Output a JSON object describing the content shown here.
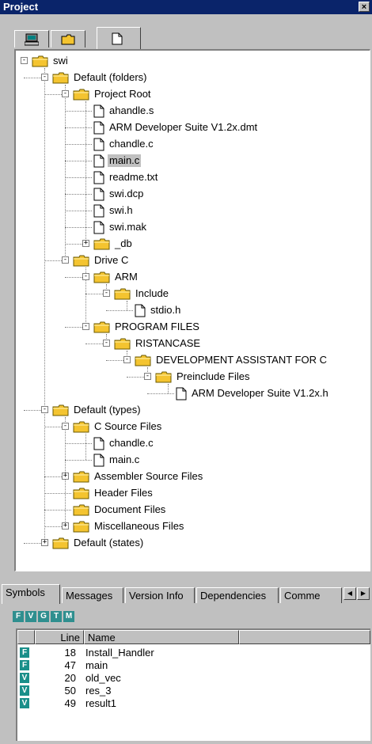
{
  "window": {
    "title": "Project",
    "close_glyph": "×"
  },
  "top_tabs": [
    {
      "icon": "computer-icon"
    },
    {
      "icon": "folder-icon"
    },
    {
      "icon": "document-icon",
      "active": true
    }
  ],
  "tree": [
    {
      "label": "swi",
      "type": "folder",
      "depth": 0,
      "expander": "-"
    },
    {
      "label": "Default (folders)",
      "type": "folder",
      "depth": 1,
      "expander": "-"
    },
    {
      "label": "Project Root",
      "type": "folder",
      "depth": 2,
      "expander": "-"
    },
    {
      "label": "ahandle.s",
      "type": "file",
      "depth": 3
    },
    {
      "label": "ARM Developer Suite V1.2x.dmt",
      "type": "file",
      "depth": 3
    },
    {
      "label": "chandle.c",
      "type": "file",
      "depth": 3
    },
    {
      "label": "main.c",
      "type": "file",
      "depth": 3,
      "selected": true
    },
    {
      "label": "readme.txt",
      "type": "file",
      "depth": 3
    },
    {
      "label": "swi.dcp",
      "type": "file",
      "depth": 3
    },
    {
      "label": "swi.h",
      "type": "file",
      "depth": 3
    },
    {
      "label": "swi.mak",
      "type": "file",
      "depth": 3
    },
    {
      "label": "_db",
      "type": "folder",
      "depth": 3,
      "expander": "+"
    },
    {
      "label": "Drive C",
      "type": "folder",
      "depth": 2,
      "expander": "-"
    },
    {
      "label": "ARM",
      "type": "folder",
      "depth": 3,
      "expander": "-"
    },
    {
      "label": "Include",
      "type": "folder",
      "depth": 4,
      "expander": "-"
    },
    {
      "label": "stdio.h",
      "type": "file",
      "depth": 5
    },
    {
      "label": "PROGRAM FILES",
      "type": "folder",
      "depth": 3,
      "expander": "-"
    },
    {
      "label": "RISTANCASE",
      "type": "folder",
      "depth": 4,
      "expander": "-"
    },
    {
      "label": "DEVELOPMENT ASSISTANT FOR C",
      "type": "folder",
      "depth": 5,
      "expander": "-"
    },
    {
      "label": "Preinclude Files",
      "type": "folder",
      "depth": 6,
      "expander": "-"
    },
    {
      "label": "ARM Developer Suite V1.2x.h",
      "type": "file",
      "depth": 7
    },
    {
      "label": "Default (types)",
      "type": "folder",
      "depth": 1,
      "expander": "-"
    },
    {
      "label": "C Source Files",
      "type": "folder",
      "depth": 2,
      "expander": "-"
    },
    {
      "label": "chandle.c",
      "type": "file",
      "depth": 3
    },
    {
      "label": "main.c",
      "type": "file",
      "depth": 3
    },
    {
      "label": "Assembler Source Files",
      "type": "folder",
      "depth": 2,
      "expander": "+"
    },
    {
      "label": "Header Files",
      "type": "folder",
      "depth": 2
    },
    {
      "label": "Document Files",
      "type": "folder",
      "depth": 2
    },
    {
      "label": "Miscellaneous Files",
      "type": "folder",
      "depth": 2,
      "expander": "+"
    },
    {
      "label": "Default (states)",
      "type": "folder",
      "depth": 1,
      "expander": "+"
    }
  ],
  "bottom_tabs": [
    {
      "label": "Symbols",
      "active": true
    },
    {
      "label": "Messages"
    },
    {
      "label": "Version Info"
    },
    {
      "label": "Dependencies"
    },
    {
      "label": "Comme"
    }
  ],
  "scroll_left_glyph": "◀",
  "scroll_right_glyph": "▶",
  "symbol_filters": [
    "F",
    "V",
    "G",
    "T",
    "M"
  ],
  "symbols_table": {
    "columns": [
      "Line",
      "Name"
    ],
    "rows": [
      {
        "kind": "F",
        "line": "18",
        "name": "Install_Handler"
      },
      {
        "kind": "F",
        "line": "47",
        "name": "main"
      },
      {
        "kind": "V",
        "line": "20",
        "name": "old_vec"
      },
      {
        "kind": "V",
        "line": "50",
        "name": "res_3"
      },
      {
        "kind": "V",
        "line": "49",
        "name": "result1"
      }
    ]
  },
  "colors": {
    "title_bar": "#0a246a",
    "folder": "#f4c430",
    "symbol_badge": "#1a8f8a",
    "selection": "#c0c0c0"
  }
}
